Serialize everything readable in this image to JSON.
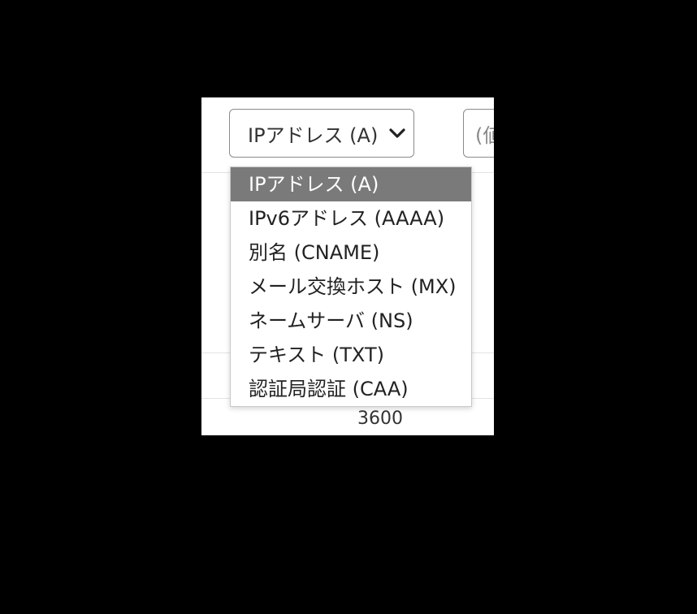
{
  "record_type_select": {
    "selected_label": "IPアドレス (A)",
    "options": [
      "IPアドレス (A)",
      "IPv6アドレス (AAAA)",
      "別名 (CNAME)",
      "メール交換ホスト (MX)",
      "ネームサーバ (NS)",
      "テキスト (TXT)",
      "認証局認証 (CAA)"
    ],
    "highlighted_index": 0,
    "chevron_icon": "chevron-down-icon"
  },
  "value_field": {
    "placeholder": "(値"
  },
  "ttl_value": "3600",
  "colors": {
    "page_background": "#000000",
    "highlight": "#7a7a7a",
    "border": "#8a8a8a"
  }
}
